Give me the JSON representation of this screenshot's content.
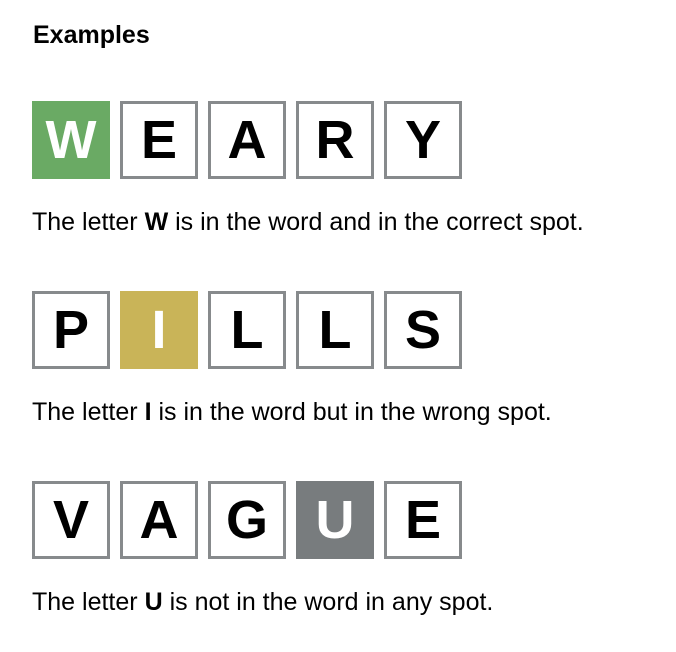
{
  "heading": "Examples",
  "colors": {
    "correct": "#6aaa64",
    "present": "#c9b458",
    "absent": "#787c7e",
    "tile_border": "#878a8c"
  },
  "examples": [
    {
      "tiles": [
        {
          "letter": "W",
          "state": "correct"
        },
        {
          "letter": "E",
          "state": "empty"
        },
        {
          "letter": "A",
          "state": "empty"
        },
        {
          "letter": "R",
          "state": "empty"
        },
        {
          "letter": "Y",
          "state": "empty"
        }
      ],
      "desc_prefix": "The letter ",
      "desc_letter": "W",
      "desc_suffix": " is in the word and in the correct spot."
    },
    {
      "tiles": [
        {
          "letter": "P",
          "state": "empty"
        },
        {
          "letter": "I",
          "state": "present"
        },
        {
          "letter": "L",
          "state": "empty"
        },
        {
          "letter": "L",
          "state": "empty"
        },
        {
          "letter": "S",
          "state": "empty"
        }
      ],
      "desc_prefix": "The letter ",
      "desc_letter": "I",
      "desc_suffix": " is in the word but in the wrong spot."
    },
    {
      "tiles": [
        {
          "letter": "V",
          "state": "empty"
        },
        {
          "letter": "A",
          "state": "empty"
        },
        {
          "letter": "G",
          "state": "empty"
        },
        {
          "letter": "U",
          "state": "absent"
        },
        {
          "letter": "E",
          "state": "empty"
        }
      ],
      "desc_prefix": "The letter ",
      "desc_letter": "U",
      "desc_suffix": " is not in the word in any spot."
    }
  ]
}
